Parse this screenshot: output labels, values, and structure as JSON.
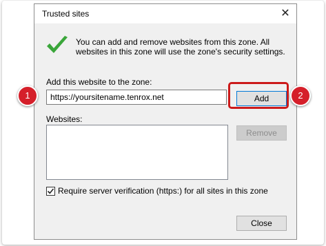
{
  "window": {
    "title": "Trusted sites",
    "close_glyph": "✕"
  },
  "info_text": "You can add and remove websites from this zone. All websites in this zone will use the zone's security settings.",
  "add_section": {
    "label": "Add this website to the zone:",
    "input_value": "https://yoursitename.tenrox.net",
    "add_label": "Add"
  },
  "websites": {
    "label": "Websites:",
    "items": [],
    "remove_label": "Remove"
  },
  "require_verification": {
    "label": "Require server verification (https:) for all sites in this zone",
    "checked": true
  },
  "close_label": "Close",
  "annotations": {
    "badge1": "1",
    "badge2": "2"
  },
  "colors": {
    "highlight": "#cc1a1a",
    "badge": "#d51f2a",
    "check": "#3aa63a",
    "accent": "#0078d7"
  }
}
